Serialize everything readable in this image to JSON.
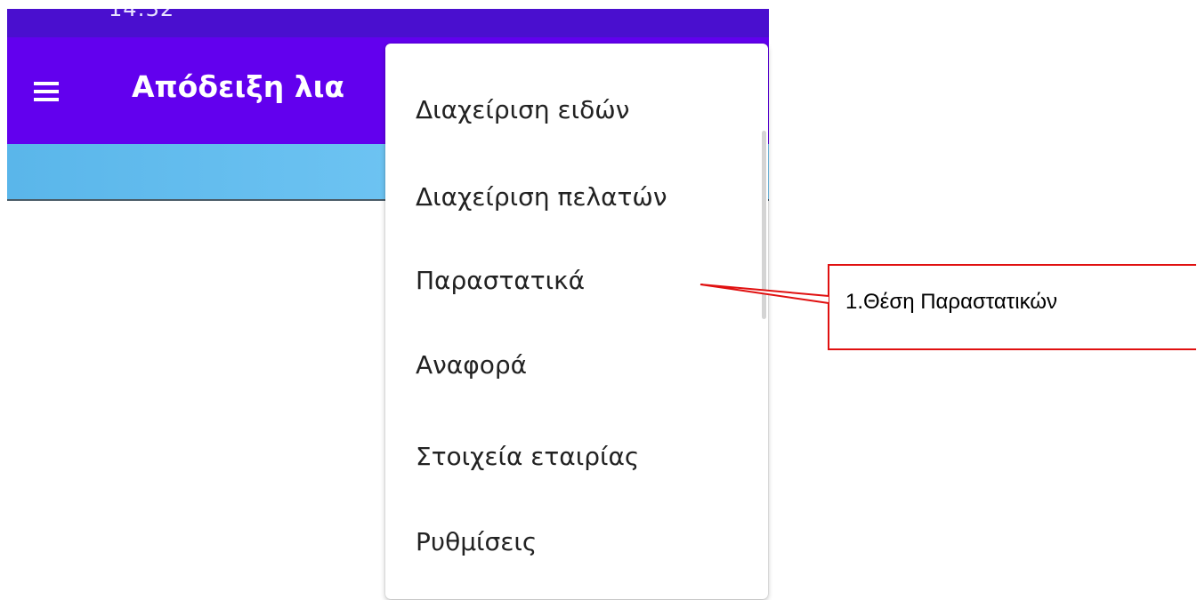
{
  "status_bar": {
    "left_text": "14:32",
    "right_text": ""
  },
  "app_bar": {
    "title": "Απόδειξη λια",
    "menu_icon": "hamburger-menu-icon"
  },
  "overflow_menu": {
    "items": [
      {
        "label": "Διαχείριση ειδών"
      },
      {
        "label": "Διαχείριση πελατών"
      },
      {
        "label": "Παραστατικά"
      },
      {
        "label": "Αναφορά"
      },
      {
        "label": "Στοιχεία εταιρίας"
      },
      {
        "label": "Ρυθμίσεις"
      }
    ]
  },
  "annotation": {
    "text": "1.Θέση Παραστατικών",
    "color": "#e01010"
  },
  "colors": {
    "app_bar": "#6200ee",
    "status_bar": "#4a0fcf",
    "tab_strip": "#6ec4f4"
  }
}
